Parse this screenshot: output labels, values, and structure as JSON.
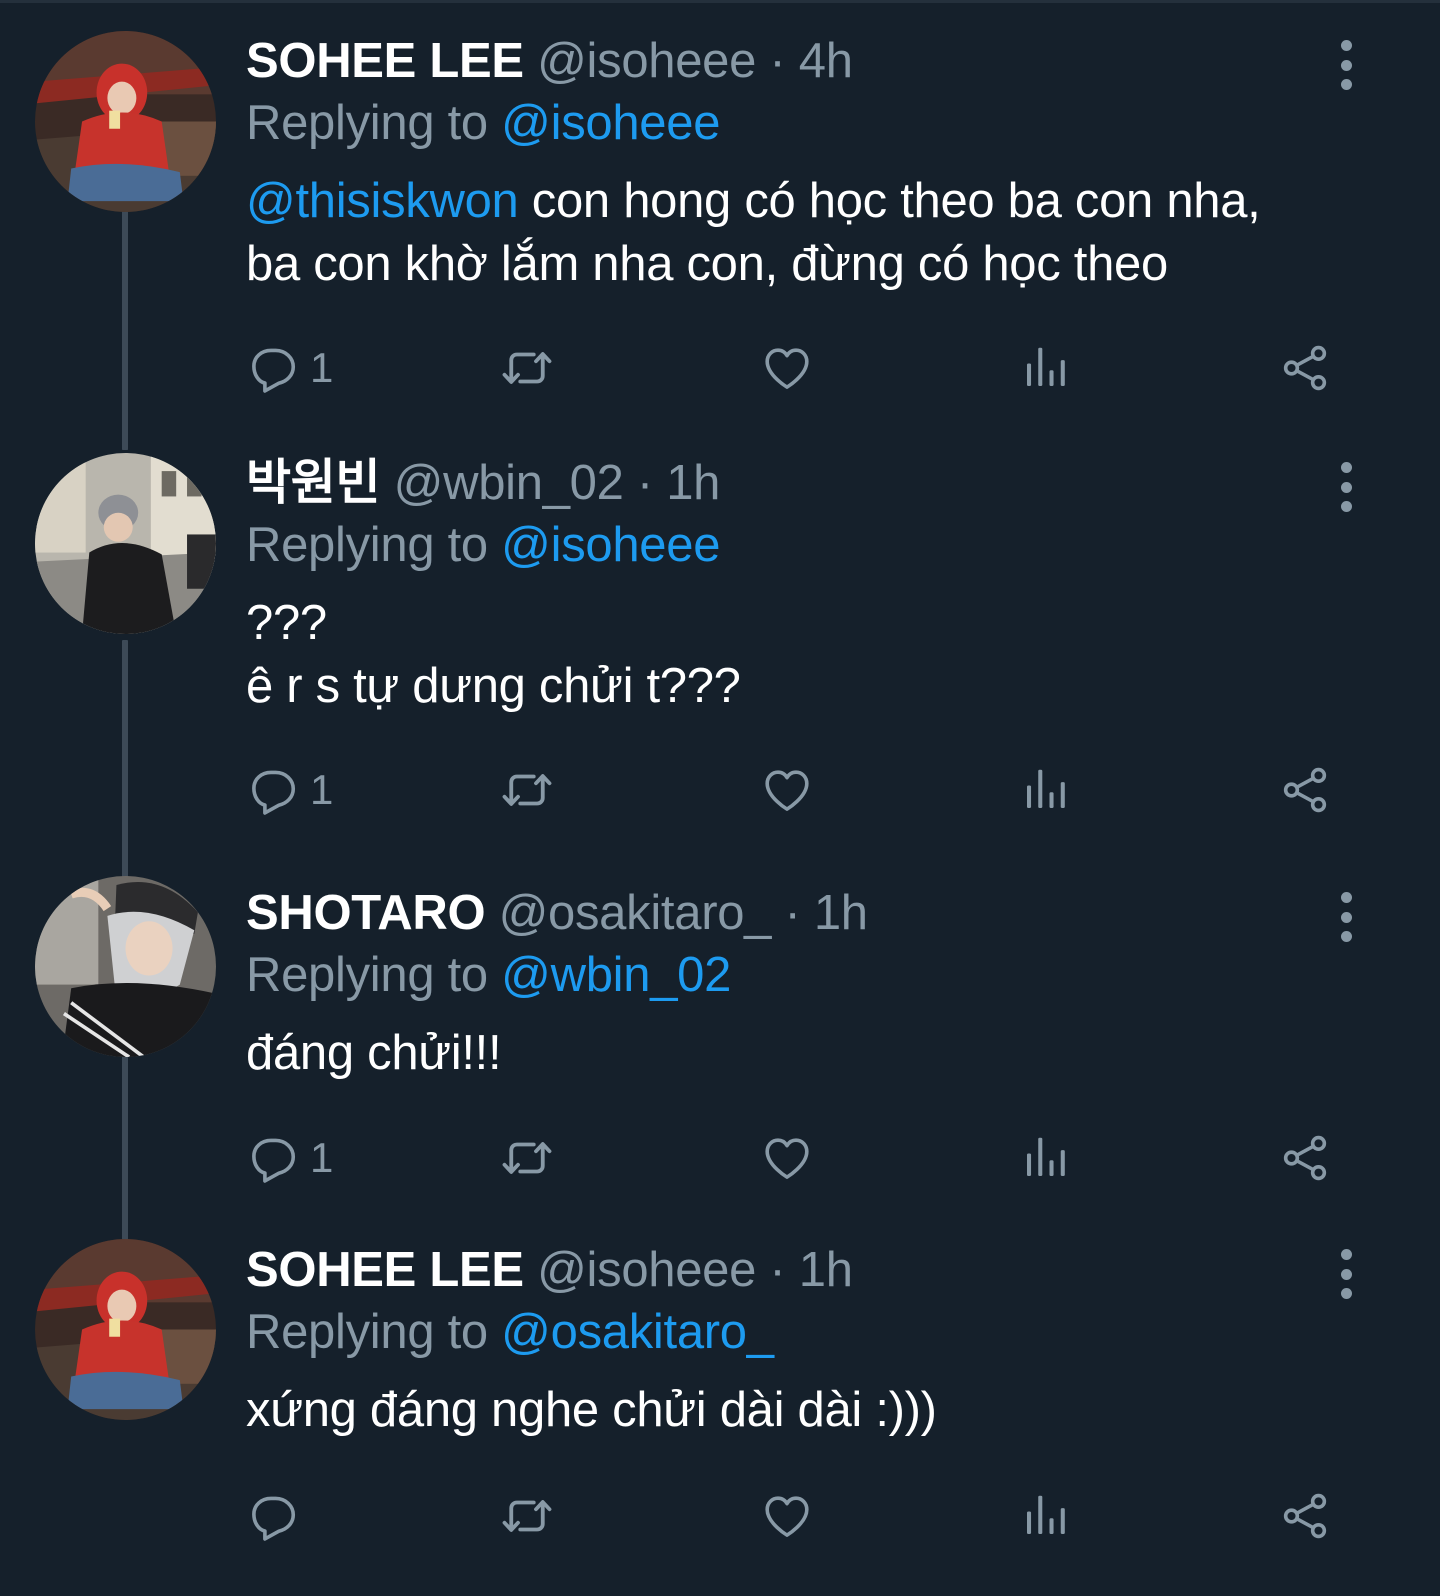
{
  "colors": {
    "background": "#15202b",
    "text_primary": "#ffffff",
    "text_secondary": "#8899a6",
    "link": "#1d9bf0",
    "thread_line": "#3d4a57"
  },
  "tweets": [
    {
      "display_name": "SOHEE LEE",
      "handle": "@isoheee",
      "separator": "·",
      "time": "4h",
      "replying_prefix": "Replying to",
      "replying_to": "@isoheee",
      "mention": "@thisiskwon",
      "line1_after_mention": " con hong có học theo ba con nha,",
      "line2": "ba con khờ lắm nha con, đừng có học theo",
      "reply_count": "1",
      "avatar_icon": "avatar-red-hoodie"
    },
    {
      "display_name": "박원빈",
      "handle": "@wbin_02",
      "separator": "·",
      "time": "1h",
      "replying_prefix": "Replying to",
      "replying_to": "@isoheee",
      "line1": "???",
      "line2": "ê r s tự dưng chửi t???",
      "reply_count": "1",
      "avatar_icon": "avatar-street-beanie"
    },
    {
      "display_name": "SHOTARO",
      "handle": "@osakitaro_",
      "separator": "·",
      "time": "1h",
      "replying_prefix": "Replying to",
      "replying_to": "@wbin_02",
      "line1": "đáng chửi!!!",
      "reply_count": "1",
      "avatar_icon": "avatar-bandana-cap"
    },
    {
      "display_name": "SOHEE LEE",
      "handle": "@isoheee",
      "separator": "·",
      "time": "1h",
      "replying_prefix": "Replying to",
      "replying_to": "@osakitaro_",
      "line1": "xứng đáng nghe chửi dài dài :)))",
      "reply_count": "",
      "avatar_icon": "avatar-red-hoodie"
    }
  ],
  "action_icons": [
    "reply-icon",
    "retweet-icon",
    "like-icon",
    "views-icon",
    "share-icon"
  ]
}
